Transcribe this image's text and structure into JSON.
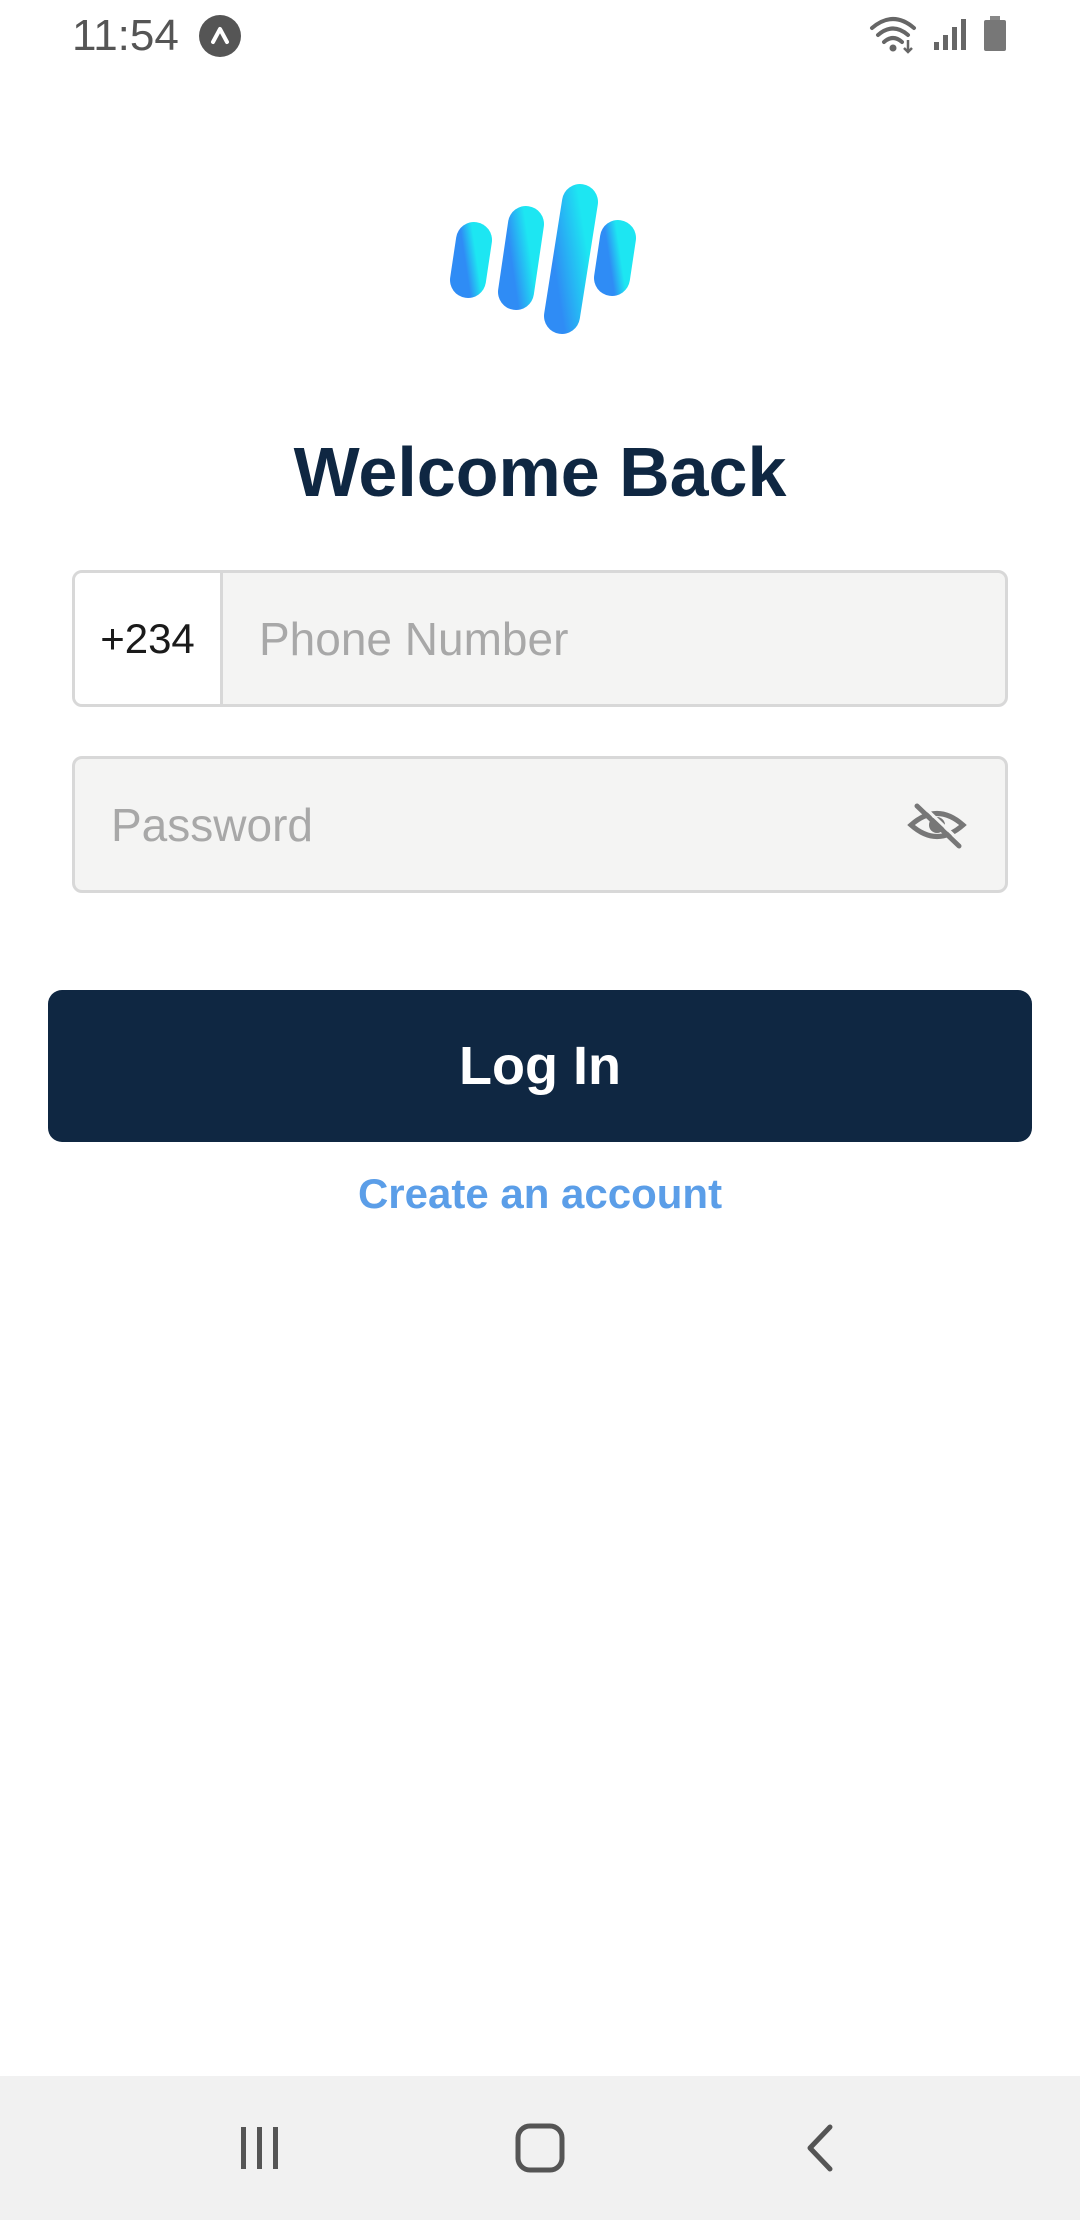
{
  "status_bar": {
    "time": "11:54"
  },
  "icons": {
    "app_notification": "a-in-circle-icon",
    "wifi": "wifi-icon",
    "signal": "cell-signal-icon",
    "battery": "battery-icon",
    "logo": "app-logo",
    "eye_toggle": "eye-off-icon",
    "nav_recents": "recents-icon",
    "nav_home": "home-icon",
    "nav_back": "back-icon"
  },
  "colors": {
    "primary": "#0f2742",
    "link": "#5b9ee8",
    "logo_gradient_start": "#2f8cf5",
    "logo_gradient_end": "#1de6f2"
  },
  "login": {
    "title": "Welcome Back",
    "country_code": "+234",
    "phone_placeholder": "Phone Number",
    "password_placeholder": "Password",
    "login_label": "Log In",
    "create_account_label": "Create an account"
  }
}
